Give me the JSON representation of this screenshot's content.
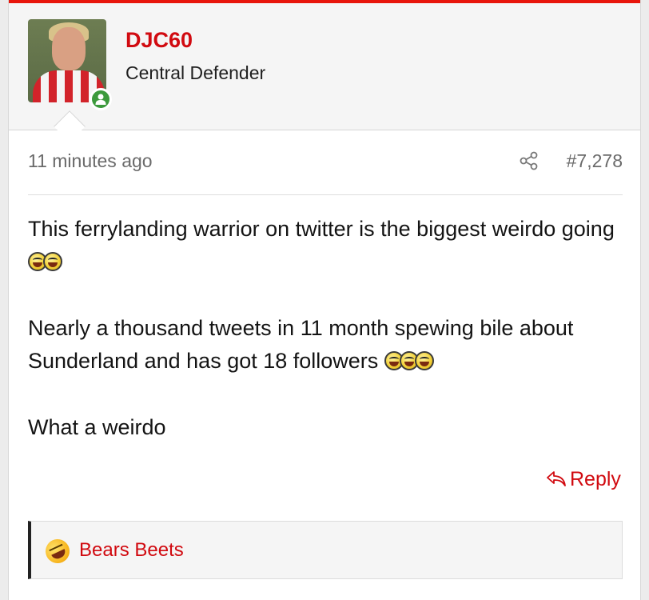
{
  "colors": {
    "accent": "#d10a10",
    "topbar": "#e8150b",
    "status_online": "#3c9a3c"
  },
  "author": {
    "username": "DJC60",
    "user_title": "Central Defender",
    "status": "online"
  },
  "post": {
    "time": "11 minutes ago",
    "number": "#7,278",
    "paragraphs": [
      "This ferrylanding warrior on twitter is the biggest weirdo going",
      "Nearly a thousand tweets in 11 month spewing bile about Sunderland and has got 18 followers",
      "What a weirdo"
    ],
    "reply_label": "Reply"
  },
  "reactions": {
    "icon": "rofl-emoji",
    "users": "Bears Beets"
  }
}
